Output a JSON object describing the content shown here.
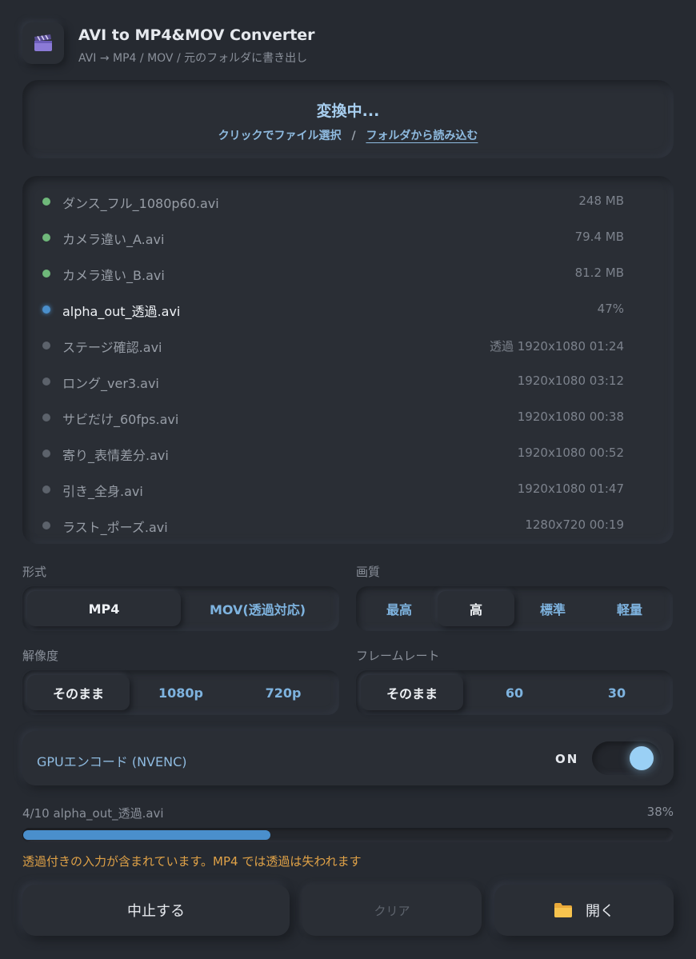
{
  "app": {
    "title": "AVI to MP4&MOV Converter",
    "subtitle": "AVI → MP4 / MOV  /  元のフォルダに書き出し",
    "icon": "clapperboard-icon"
  },
  "dropzone": {
    "status": "変換中...",
    "select_files": "クリックでファイル選択",
    "separator": "/",
    "load_folder": "フォルダから読み込む"
  },
  "files": [
    {
      "name": "ダンス_フル_1080p60.avi",
      "meta": "248 MB",
      "state": "done"
    },
    {
      "name": "カメラ違い_A.avi",
      "meta": "79.4 MB",
      "state": "done"
    },
    {
      "name": "カメラ違い_B.avi",
      "meta": "81.2 MB",
      "state": "done"
    },
    {
      "name": "alpha_out_透過.avi",
      "meta": "47%",
      "state": "active"
    },
    {
      "name": "ステージ確認.avi",
      "meta": "透過 1920x1080 01:24",
      "state": "pending"
    },
    {
      "name": "ロング_ver3.avi",
      "meta": "1920x1080 03:12",
      "state": "pending"
    },
    {
      "name": "サビだけ_60fps.avi",
      "meta": "1920x1080 00:38",
      "state": "pending"
    },
    {
      "name": "寄り_表情差分.avi",
      "meta": "1920x1080 00:52",
      "state": "pending"
    },
    {
      "name": "引き_全身.avi",
      "meta": "1920x1080 01:47",
      "state": "pending"
    },
    {
      "name": "ラスト_ポーズ.avi",
      "meta": "1280x720 00:19",
      "state": "pending"
    }
  ],
  "settings": {
    "format": {
      "label": "形式",
      "options": [
        "MP4",
        "MOV(透過対応)"
      ],
      "selected": 0
    },
    "quality": {
      "label": "画質",
      "options": [
        "最高",
        "高",
        "標準",
        "軽量"
      ],
      "selected": 1
    },
    "resolution": {
      "label": "解像度",
      "options": [
        "そのまま",
        "1080p",
        "720p"
      ],
      "selected": 0
    },
    "framerate": {
      "label": "フレームレート",
      "options": [
        "そのまま",
        "60",
        "30"
      ],
      "selected": 0
    }
  },
  "gpu": {
    "label": "GPUエンコード (NVENC)",
    "state": "ON",
    "enabled": true
  },
  "progress": {
    "label": "4/10 alpha_out_透過.avi",
    "percent_text": "38%",
    "fraction": 0.38
  },
  "warning": "透過付きの入力が含まれています。MP4 では透過は失われます",
  "actions": {
    "stop": "中止する",
    "clear": "クリア",
    "open": "開く"
  },
  "colors": {
    "done": "#6fb87a",
    "active": "#4a8fcc",
    "pending": "#5c626b",
    "accent": "#8fbbe0",
    "warning": "#e0a247"
  }
}
